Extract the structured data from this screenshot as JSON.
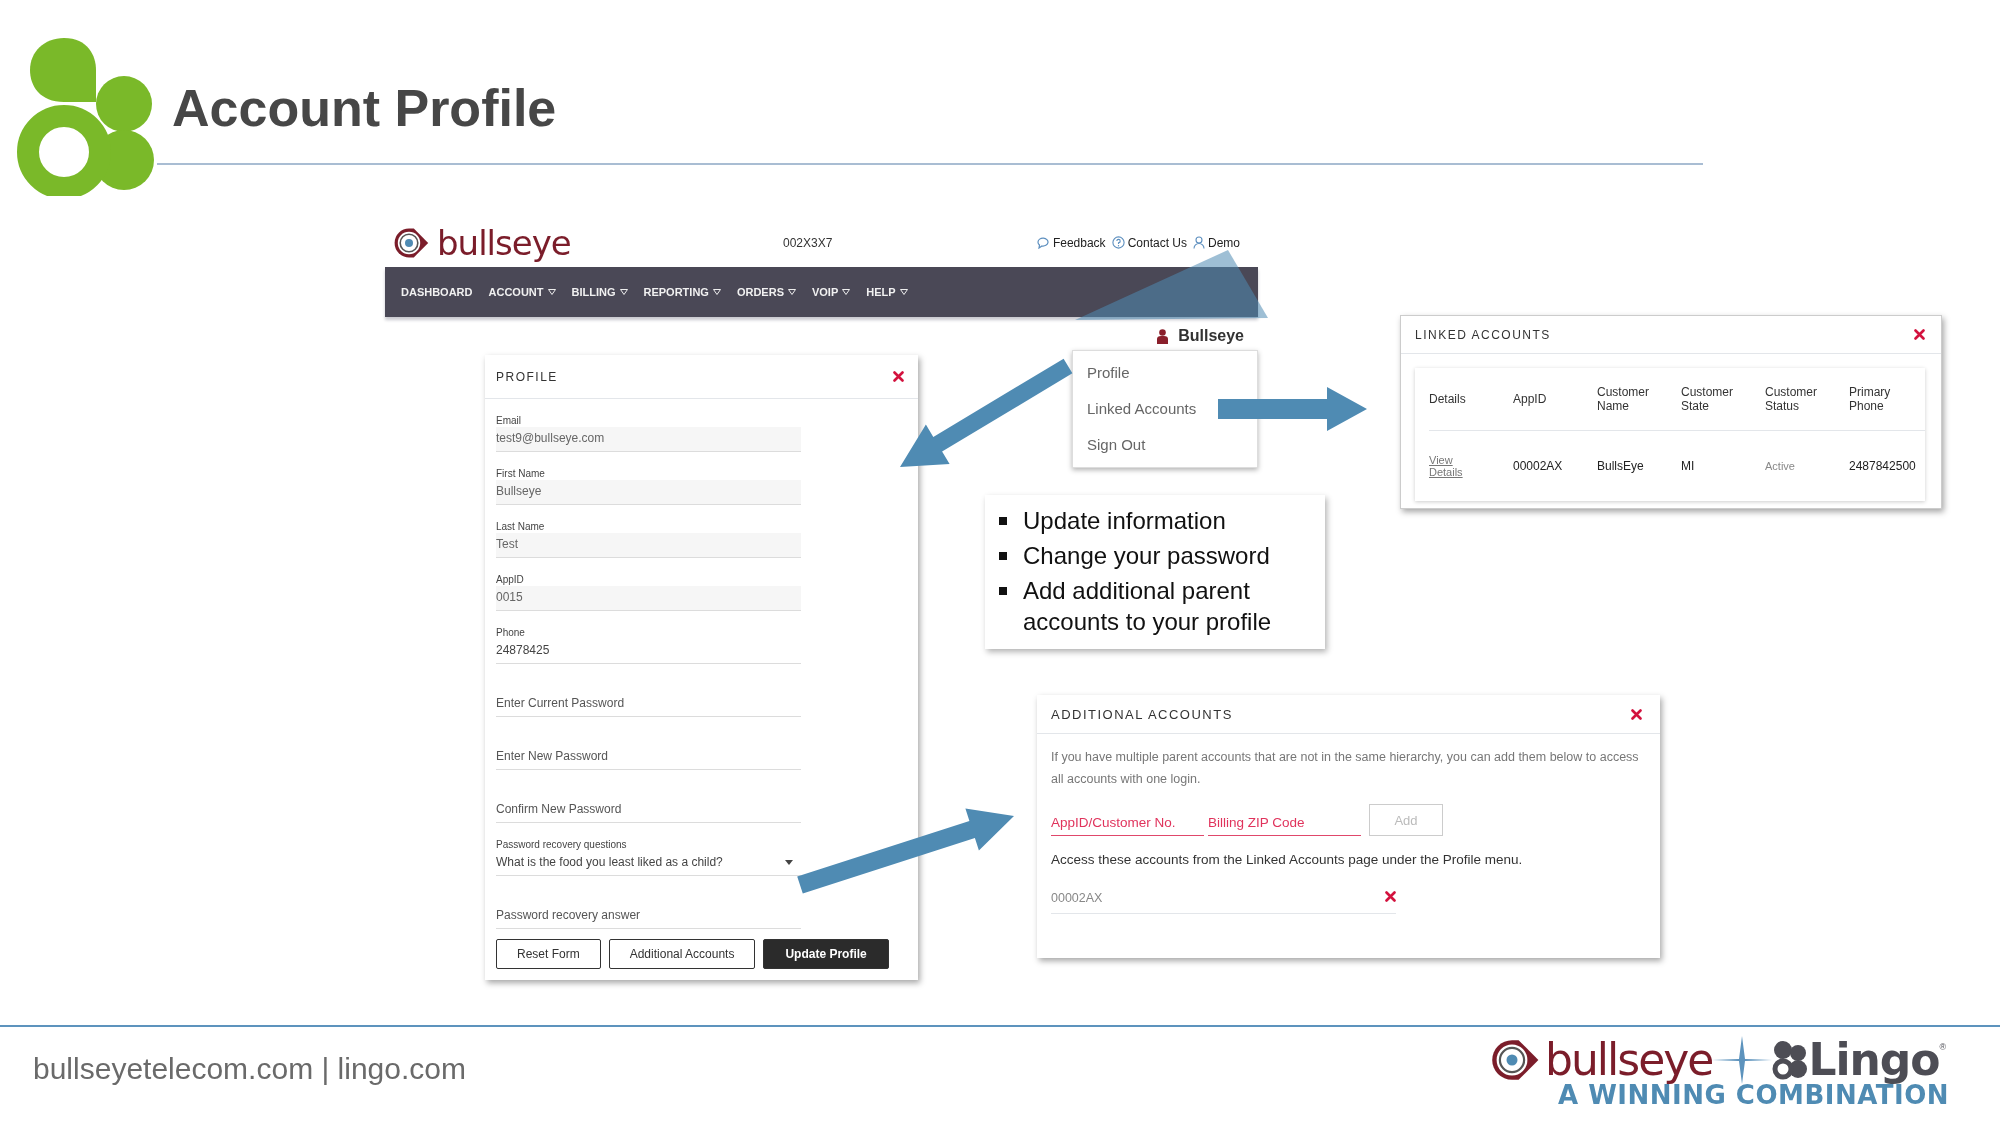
{
  "slide": {
    "title": "Account Profile",
    "footer_text": "bullseyetelecom.com | lingo.com"
  },
  "app_header": {
    "logo": "bullseye",
    "account_number": "002X3X7",
    "links": [
      "Feedback",
      "Contact Us",
      "Demo"
    ]
  },
  "nav": [
    {
      "label": "DASHBOARD",
      "has_menu": false
    },
    {
      "label": "ACCOUNT",
      "has_menu": true
    },
    {
      "label": "BILLING",
      "has_menu": true
    },
    {
      "label": "REPORTING",
      "has_menu": true
    },
    {
      "label": "ORDERS",
      "has_menu": true
    },
    {
      "label": "VOIP",
      "has_menu": true
    },
    {
      "label": "HELP",
      "has_menu": true
    }
  ],
  "user_menu": {
    "name": "Bullseye",
    "items": [
      "Profile",
      "Linked Accounts",
      "Sign Out"
    ]
  },
  "profile_panel": {
    "title": "PROFILE",
    "fields": [
      {
        "kind": "text",
        "label": "Email",
        "value": "test9@bullseye.com",
        "readonly": true
      },
      {
        "kind": "text",
        "label": "First Name",
        "value": "Bullseye",
        "readonly": true
      },
      {
        "kind": "text",
        "label": "Last Name",
        "value": "Test",
        "readonly": true
      },
      {
        "kind": "text",
        "label": "AppID",
        "value": "0015",
        "readonly": true
      },
      {
        "kind": "text",
        "label": "Phone",
        "value": "24878425",
        "readonly": false
      },
      {
        "kind": "text",
        "placeholder": "Enter Current Password"
      },
      {
        "kind": "text",
        "placeholder": "Enter New Password"
      },
      {
        "kind": "text",
        "placeholder": "Confirm New Password"
      },
      {
        "kind": "select",
        "label": "Password recovery questions",
        "value": "What is the food you least liked as a child?"
      },
      {
        "kind": "text",
        "placeholder": "Password recovery answer"
      }
    ],
    "buttons": [
      {
        "label": "Reset Form",
        "primary": false
      },
      {
        "label": "Additional Accounts",
        "primary": false
      },
      {
        "label": "Update Profile",
        "primary": true
      }
    ]
  },
  "bullets": [
    "Update information",
    "Change your password",
    "Add additional parent accounts to your profile"
  ],
  "linked_accounts_panel": {
    "title": "LINKED ACCOUNTS",
    "columns": [
      "Details",
      "AppID",
      "Customer Name",
      "Customer State",
      "Customer Status",
      "Primary Phone"
    ],
    "rows": [
      {
        "cells": [
          {
            "text": "View Details",
            "kind": "link"
          },
          {
            "text": "00002AX",
            "kind": "text"
          },
          {
            "text": "BullsEye",
            "kind": "text"
          },
          {
            "text": "MI",
            "kind": "text"
          },
          {
            "text": "Active",
            "kind": "muted"
          },
          {
            "text": "2487842500",
            "kind": "text"
          }
        ]
      }
    ]
  },
  "additional_accounts_panel": {
    "title": "ADDITIONAL ACCOUNTS",
    "description": "If you have multiple parent accounts that are not in the same hierarchy, you can add them below to access all accounts with one login.",
    "fields": [
      {
        "placeholder": "AppID/Customer No."
      },
      {
        "placeholder": "Billing ZIP Code"
      }
    ],
    "add_button": {
      "label": "Add",
      "disabled": true
    },
    "note": "Access these accounts from the Linked Accounts page under the Profile menu.",
    "accounts": [
      "00002AX"
    ]
  },
  "footer_logo": {
    "brand_1": "bullseye",
    "brand_2": "Lingo",
    "registered": "®",
    "tagline": "A WINNING COMBINATION"
  }
}
